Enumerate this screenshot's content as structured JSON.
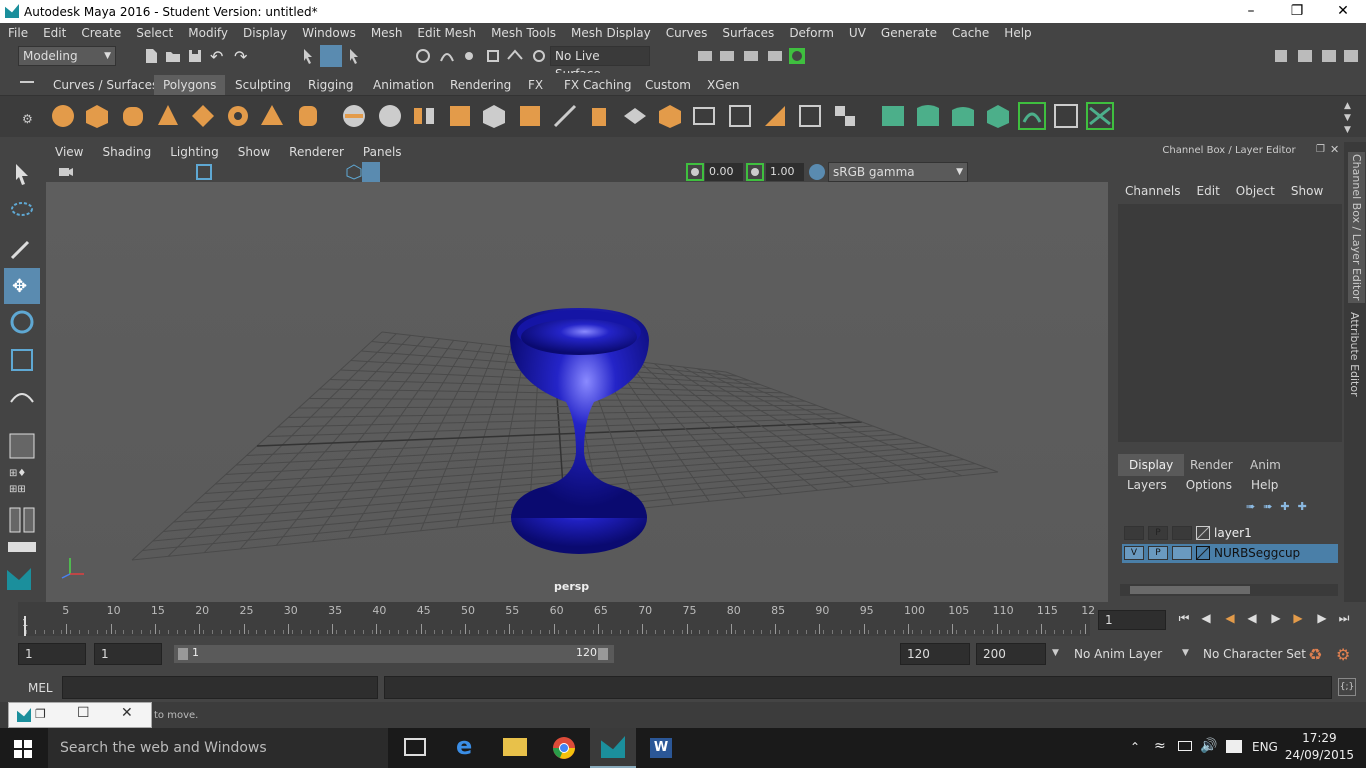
{
  "window": {
    "title": "Autodesk Maya 2016 - Student Version: untitled*"
  },
  "menubar": [
    "File",
    "Edit",
    "Create",
    "Select",
    "Modify",
    "Display",
    "Windows",
    "Mesh",
    "Edit Mesh",
    "Mesh Tools",
    "Mesh Display",
    "Curves",
    "Surfaces",
    "Deform",
    "UV",
    "Generate",
    "Cache",
    "Help"
  ],
  "statusline": {
    "mode": "Modeling",
    "live_surface": "No Live Surface"
  },
  "shelf_tabs": [
    "Curves / Surfaces",
    "Polygons",
    "Sculpting",
    "Rigging",
    "Animation",
    "Rendering",
    "FX",
    "FX Caching",
    "Custom",
    "XGen"
  ],
  "viewport": {
    "menu": [
      "View",
      "Shading",
      "Lighting",
      "Show",
      "Renderer",
      "Panels"
    ],
    "exposure": "0.00",
    "gamma": "1.00",
    "color_space": "sRGB gamma",
    "camera_label": "persp"
  },
  "channel_box": {
    "title": "Channel Box / Layer Editor",
    "menu": [
      "Channels",
      "Edit",
      "Object",
      "Show"
    ],
    "layer_tabs": [
      "Display",
      "Render",
      "Anim"
    ],
    "layer_menu": [
      "Layers",
      "Options",
      "Help"
    ],
    "layers": [
      {
        "name": "layer1",
        "v": "",
        "p": "P"
      },
      {
        "name": "NURBSeggcup",
        "v": "V",
        "p": "P"
      }
    ]
  },
  "side_tabs": [
    "Channel Box / Layer Editor",
    "Attribute Editor"
  ],
  "timeline": {
    "ticks": [
      "5",
      "10",
      "15",
      "20",
      "25",
      "30",
      "35",
      "40",
      "45",
      "50",
      "55",
      "60",
      "65",
      "70",
      "75",
      "80",
      "85",
      "90",
      "95",
      "100",
      "105",
      "110",
      "115",
      "12"
    ],
    "start_marker": "1",
    "current_frame": "1"
  },
  "range": {
    "start": "1",
    "playback_start": "1",
    "slider_start": "1",
    "slider_end": "120",
    "playback_end": "120",
    "end": "200",
    "anim_layer": "No Anim Layer",
    "character_set": "No Character Set"
  },
  "command_line": {
    "language": "MEL"
  },
  "help_line": {
    "text": "to move."
  },
  "taskbar": {
    "search_placeholder": "Search the web and Windows",
    "language": "ENG",
    "time": "17:29",
    "date": "24/09/2015"
  },
  "colors": {
    "object": "#1a1aa0",
    "accent_highlight": "#4a7fa8",
    "shelf_orange": "#e39b4a",
    "shelf_green": "#4caf8a"
  }
}
